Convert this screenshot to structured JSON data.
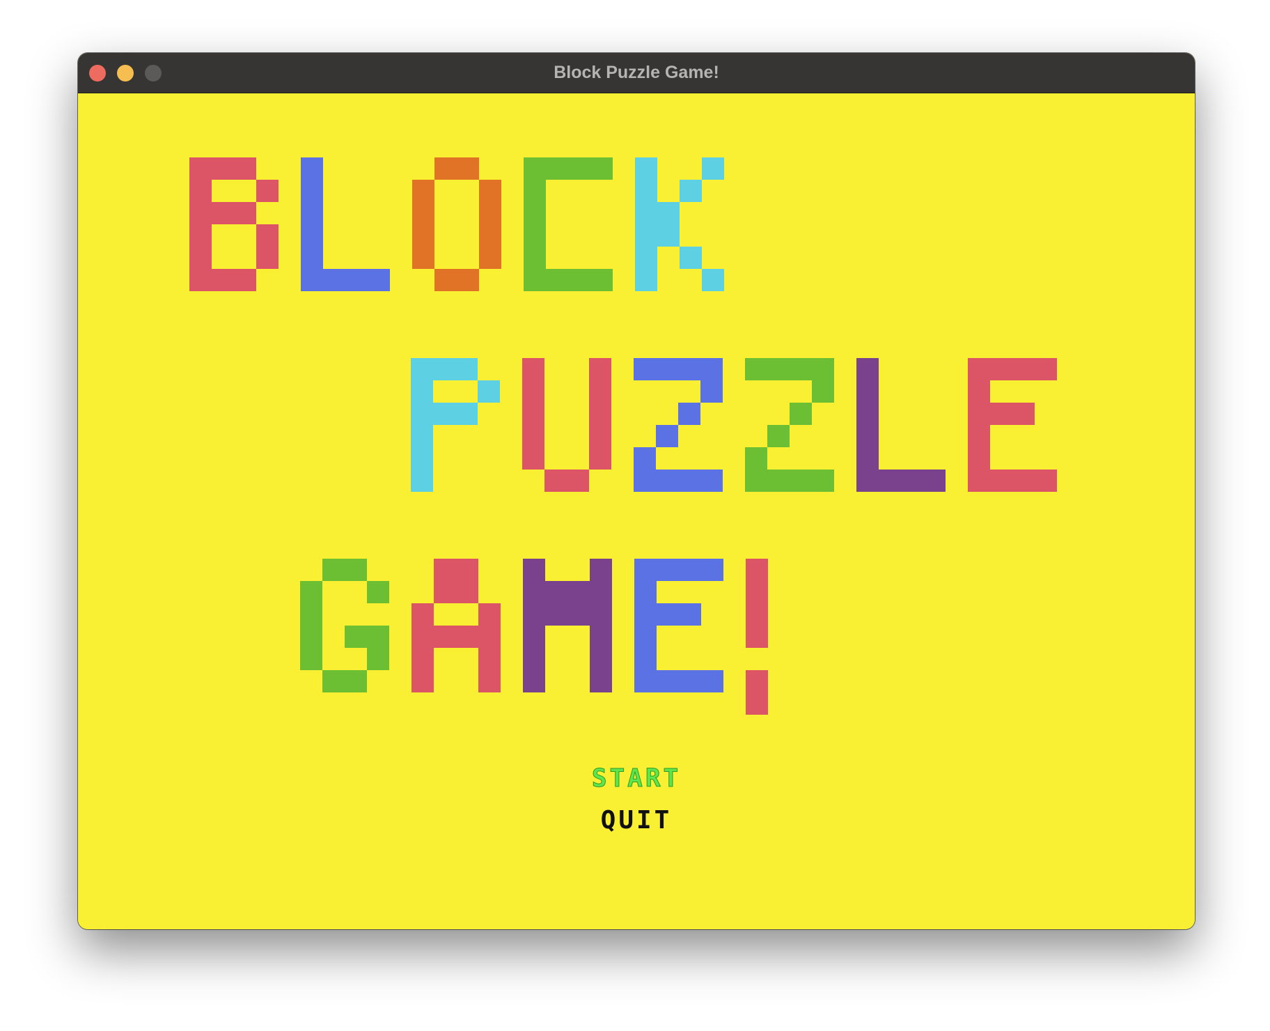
{
  "window": {
    "title": "Block Puzzle Game!"
  },
  "title_art": {
    "lines": [
      {
        "word": "BLOCK",
        "letters": [
          {
            "char": "B",
            "color": "#dc5567"
          },
          {
            "char": "L",
            "color": "#5b72e4"
          },
          {
            "char": "O",
            "color": "#e07326"
          },
          {
            "char": "C",
            "color": "#6cbe33"
          },
          {
            "char": "K",
            "color": "#5ed0e3"
          }
        ]
      },
      {
        "word": "PUZZLE",
        "letters": [
          {
            "char": "P",
            "color": "#5ed0e3"
          },
          {
            "char": "U",
            "color": "#dc5567"
          },
          {
            "char": "Z",
            "color": "#5b72e4"
          },
          {
            "char": "Z",
            "color": "#6cbe33"
          },
          {
            "char": "L",
            "color": "#7a418c"
          },
          {
            "char": "E",
            "color": "#dc5567"
          }
        ]
      },
      {
        "word": "GAME!",
        "letters": [
          {
            "char": "G",
            "color": "#6cbe33"
          },
          {
            "char": "A",
            "color": "#dc5567"
          },
          {
            "char": "M",
            "color": "#7a418c"
          },
          {
            "char": "E",
            "color": "#5b72e4"
          },
          {
            "char": "!",
            "color": "#dc5567"
          }
        ]
      }
    ]
  },
  "menu": {
    "start_label": "START",
    "quit_label": "QUIT",
    "selected": "START",
    "selected_color": "#5fe64c",
    "unselected_color": "#111111"
  },
  "colors": {
    "background": "#f9f034",
    "titlebar": "#373533"
  }
}
